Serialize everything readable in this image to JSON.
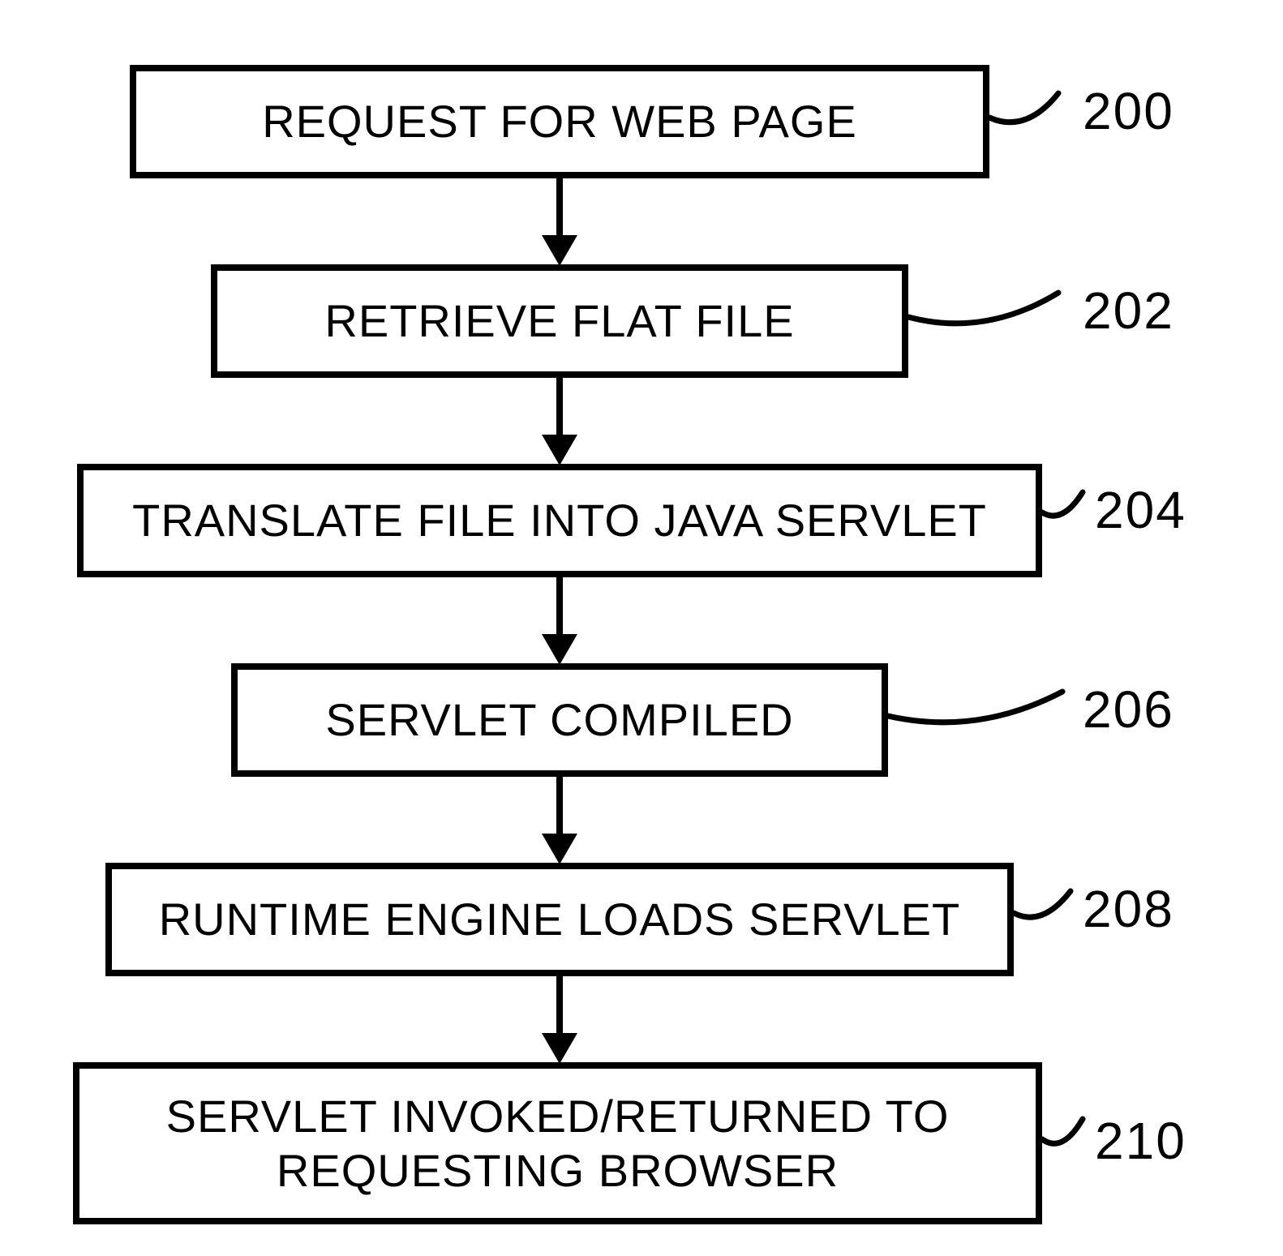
{
  "flow": {
    "steps": [
      {
        "label": "REQUEST FOR WEB PAGE",
        "ref": "200"
      },
      {
        "label": "RETRIEVE FLAT FILE",
        "ref": "202"
      },
      {
        "label": "TRANSLATE FILE INTO JAVA SERVLET",
        "ref": "204"
      },
      {
        "label": "SERVLET COMPILED",
        "ref": "206"
      },
      {
        "label": "RUNTIME ENGINE LOADS SERVLET",
        "ref": "208"
      },
      {
        "label": "SERVLET INVOKED/RETURNED TO\nREQUESTING BROWSER",
        "ref": "210"
      }
    ]
  }
}
